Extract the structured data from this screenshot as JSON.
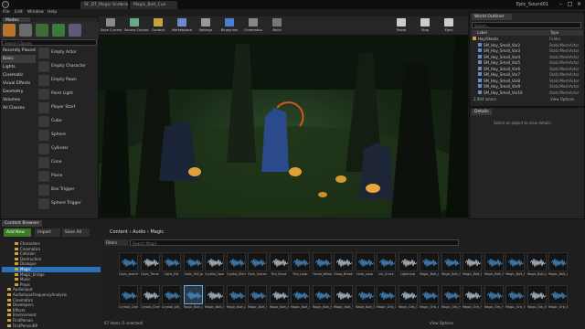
{
  "title_bar": {
    "tabs": [
      "SF_DT_Magic-Sndbrain01",
      "Magic_Bolt_Cue"
    ],
    "window_title": "Epic_Sound01",
    "controls": [
      "–",
      "□",
      "×"
    ]
  },
  "menu": [
    "File",
    "Edit",
    "Window",
    "Help"
  ],
  "modes": {
    "tab": "Modes",
    "search_placeholder": "Search Classes",
    "categories": [
      "Recently Placed",
      "Basic",
      "Lights",
      "Cinematic",
      "Visual Effects",
      "Geometry",
      "Volumes",
      "All Classes"
    ],
    "selected_category": "Basic",
    "items": [
      "Empty Actor",
      "Empty Character",
      "Empty Pawn",
      "Point Light",
      "Player Start",
      "Cube",
      "Sphere",
      "Cylinder",
      "Cone",
      "Plane",
      "Box Trigger",
      "Sphere Trigger"
    ]
  },
  "toolbar": {
    "buttons": [
      {
        "label": "Save Current",
        "icon": "save-icon",
        "color": "#8a8a8a"
      },
      {
        "label": "Source Control",
        "icon": "source-control-icon",
        "color": "#6a8"
      },
      {
        "label": "Content",
        "icon": "content-icon",
        "color": "#c9a23a"
      },
      {
        "label": "Marketplace",
        "icon": "marketplace-icon",
        "color": "#6a8ac9"
      },
      {
        "label": "Settings",
        "icon": "gear-icon",
        "color": "#999"
      },
      {
        "label": "Blueprints",
        "icon": "blueprint-icon",
        "color": "#4a7fd0"
      },
      {
        "label": "Cinematics",
        "icon": "cinematics-icon",
        "color": "#888"
      },
      {
        "label": "Build",
        "icon": "build-icon",
        "color": "#777"
      },
      {
        "label": "Pause",
        "icon": "pause-icon",
        "color": "#ccc"
      },
      {
        "label": "Stop",
        "icon": "stop-icon",
        "color": "#ccc"
      },
      {
        "label": "Eject",
        "icon": "eject-icon",
        "color": "#ccc"
      }
    ]
  },
  "outliner": {
    "tab": "World Outliner",
    "search_placeholder": "Search...",
    "columns": [
      "Label",
      "Type"
    ],
    "rows": [
      {
        "label": "Hay/Stacks",
        "type": "Folder"
      },
      {
        "label": "SM_Hay_Small_Var2",
        "type": "StaticMeshActor"
      },
      {
        "label": "SM_Hay_Small_Var3",
        "type": "StaticMeshActor"
      },
      {
        "label": "SM_Hay_Small_Var4",
        "type": "StaticMeshActor"
      },
      {
        "label": "SM_Hay_Small_Var5",
        "type": "StaticMeshActor"
      },
      {
        "label": "SM_Hay_Small_Var6",
        "type": "StaticMeshActor"
      },
      {
        "label": "SM_Hay_Small_Var7",
        "type": "StaticMeshActor"
      },
      {
        "label": "SM_Hay_Small_Var8",
        "type": "StaticMeshActor"
      },
      {
        "label": "SM_Hay_Small_Var9",
        "type": "StaticMeshActor"
      },
      {
        "label": "SM_Hay_Small_Var10",
        "type": "StaticMeshActor"
      }
    ],
    "count": "2,904 actors",
    "view_options": "View Options"
  },
  "details": {
    "tab": "Details",
    "empty_message": "Select an object to view details."
  },
  "content_browser": {
    "tab": "Content Browser",
    "add_new": "Add New",
    "import": "Import",
    "save_all": "Save All",
    "breadcrumb": [
      "Content",
      "Audio",
      "Magic"
    ],
    "filters": "Filters",
    "search_placeholder": "Search Magic",
    "tree": [
      "Characters",
      "Cinematics",
      "Collision",
      "Destruction",
      "Dialogue",
      "Magic",
      "Magic_bridge",
      "Music",
      "Props",
      "Audioinput",
      "AudioInputFrequencyAnalysis",
      "Cinematics",
      "Developers",
      "Effects",
      "Environment",
      "FirstPerson",
      "FirstPersonBP"
    ],
    "selected_tree": "Magic",
    "row1_labels": [
      "Cave_wormh_Opening_1",
      "Cave_Trmor",
      "Cave_Ext",
      "Chain_Fall_bolt",
      "Crystal_Sparkle",
      "Crystal_Shimmer",
      "Dark_Vortex",
      "Fire_Burst",
      "Fire_Loop",
      "Flame_Whoosh",
      "Glass_Break",
      "Hum_Loop",
      "Ice_Crack",
      "Lightning",
      "Magic_Bolt_Cue",
      "Magic_Bolt_Fire",
      "Magic_Bolt_Fire002",
      "Magic_Bolt_Fire003",
      "Magic_Bolt_Fire004",
      "Magic_Bolt_Impact",
      "Magic_Bolt_Impact002",
      "Magic_Bolt_Impact003"
    ],
    "row2_labels": [
      "Crystal_Chime_001",
      "Crystal_Chime_002",
      "Crystal_Lift_003",
      "Magic_Bolt_Cue",
      "Magic_Bolt_Loop_01",
      "Magic_Bolt_Loop_02",
      "Magic_Bolt_Spell_Impact",
      "Magic_Bolt_Spell_Impact2",
      "Magic_Bolt_Switch",
      "Magic_Bolt_Swoosh",
      "Magic_Bolt_Tail",
      "Magic_Bolt_Tail2",
      "Magic_Orb_Open",
      "Magic_Orb_Close",
      "Magic_Orb_Loop",
      "Magic_Orb_Hum",
      "Magic_Orb_Hum2",
      "Magic_Orb_Hum3",
      "Magic_Orb_Hum4",
      "Magic_Orb_End",
      "Magic_Orb_End2",
      "Magic_Orb_End3"
    ],
    "status": "67 items (1 selected)",
    "view_options": "View Options"
  },
  "colors": {
    "accent_green": "#4c9a2a",
    "selection_blue": "#2d6fb3",
    "sound_wave_blue": "#4f9de0",
    "viewport_green": "#2d4a2a"
  }
}
